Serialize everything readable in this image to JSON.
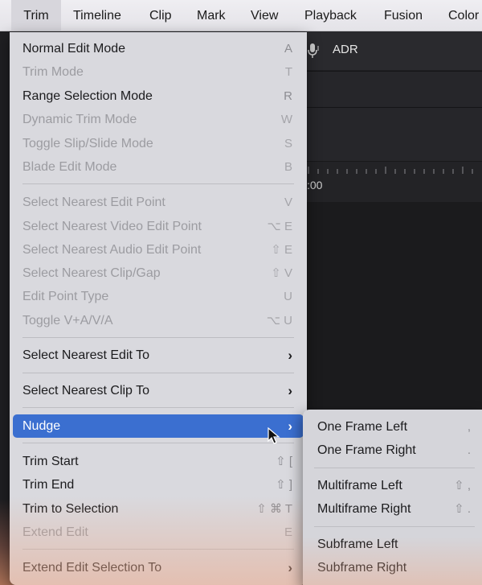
{
  "menubar": {
    "items": [
      {
        "label": "Trim"
      },
      {
        "label": "Timeline"
      },
      {
        "label": "Clip"
      },
      {
        "label": "Mark"
      },
      {
        "label": "View"
      },
      {
        "label": "Playback"
      },
      {
        "label": "Fusion"
      },
      {
        "label": "Color"
      }
    ]
  },
  "background": {
    "adr_label": "ADR",
    "timecode": ":00"
  },
  "trim_menu": {
    "items": [
      {
        "label": "Normal Edit Mode",
        "shortcut": "A"
      },
      {
        "label": "Trim Mode",
        "shortcut": "T"
      },
      {
        "label": "Range Selection Mode",
        "shortcut": "R"
      },
      {
        "label": "Dynamic Trim Mode",
        "shortcut": "W"
      },
      {
        "label": "Toggle Slip/Slide Mode",
        "shortcut": "S"
      },
      {
        "label": "Blade Edit Mode",
        "shortcut": "B"
      },
      {
        "label": "Select Nearest Edit Point",
        "shortcut": "V"
      },
      {
        "label": "Select Nearest Video Edit Point",
        "shortcut": "⌥ E"
      },
      {
        "label": "Select Nearest Audio Edit Point",
        "shortcut": "⇧ E"
      },
      {
        "label": "Select Nearest Clip/Gap",
        "shortcut": "⇧ V"
      },
      {
        "label": "Edit Point Type",
        "shortcut": "U"
      },
      {
        "label": "Toggle V+A/V/A",
        "shortcut": "⌥ U"
      },
      {
        "label": "Select Nearest Edit To",
        "shortcut": "›"
      },
      {
        "label": "Select Nearest Clip To",
        "shortcut": "›"
      },
      {
        "label": "Nudge",
        "shortcut": "›"
      },
      {
        "label": "Trim Start",
        "shortcut": "⇧ ["
      },
      {
        "label": "Trim End",
        "shortcut": "⇧ ]"
      },
      {
        "label": "Trim to Selection",
        "shortcut": "⇧ ⌘ T"
      },
      {
        "label": "Extend Edit",
        "shortcut": "E"
      },
      {
        "label": "Extend Edit Selection To",
        "shortcut": "›"
      }
    ]
  },
  "nudge_submenu": {
    "items": [
      {
        "label": "One Frame Left",
        "shortcut": ","
      },
      {
        "label": "One Frame Right",
        "shortcut": "."
      },
      {
        "label": "Multiframe Left",
        "shortcut": "⇧ ,"
      },
      {
        "label": "Multiframe Right",
        "shortcut": "⇧ ."
      },
      {
        "label": "Subframe Left",
        "shortcut": ""
      },
      {
        "label": "Subframe Right",
        "shortcut": ""
      }
    ]
  },
  "colors": {
    "highlight": "#3b6fd0",
    "menu_bg": "#d9d9de"
  }
}
